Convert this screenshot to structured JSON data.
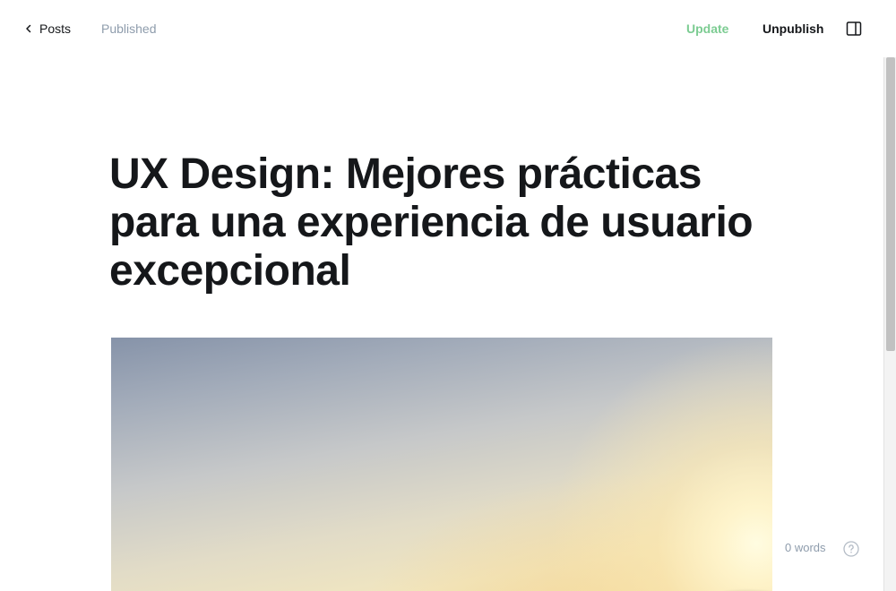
{
  "topbar": {
    "back_label": "Posts",
    "status": "Published",
    "update_label": "Update",
    "unpublish_label": "Unpublish",
    "icons": {
      "back": "chevron-left-icon",
      "sidebar_toggle": "sidebar-toggle-icon"
    }
  },
  "editor": {
    "title": "UX Design: Mejores prácticas para una experiencia de usuario excepcional",
    "word_count": "0 words",
    "help_icon": "help-circle-icon"
  },
  "colors": {
    "accent_green": "#7ccc92",
    "text_primary": "#15171a",
    "text_muted": "#8e9cac"
  }
}
